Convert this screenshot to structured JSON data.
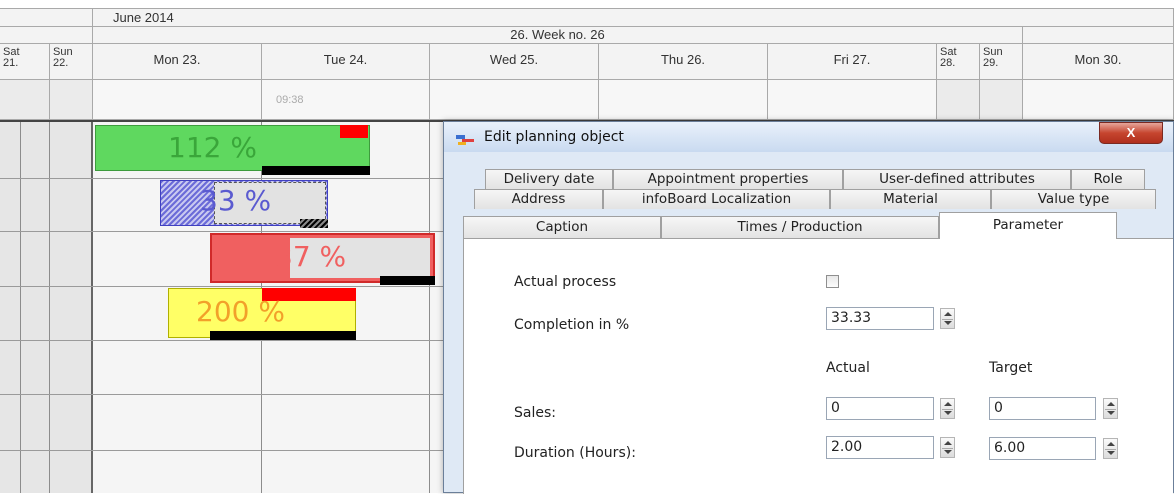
{
  "calendar": {
    "month_label": "June 2014",
    "week_label": "26. Week no. 26",
    "days": [
      {
        "label": "Sat\n21."
      },
      {
        "label": "Sun\n22."
      },
      {
        "label": "Mon 23."
      },
      {
        "label": "Tue 24."
      },
      {
        "label": "Wed 25."
      },
      {
        "label": "Thu 26."
      },
      {
        "label": "Fri 27."
      },
      {
        "label": "Sat\n28."
      },
      {
        "label": "Sun\n29."
      },
      {
        "label": "Mon 30."
      }
    ],
    "current_time": "09:38",
    "bars": [
      {
        "label": "112 %",
        "color": "#5fd85f",
        "text_color": "#3aa63a"
      },
      {
        "label": "33 %",
        "color": "#6b6bd8",
        "text_color": "#5a5ad0"
      },
      {
        "label": "37 %",
        "color": "#f06060",
        "text_color": "#f06060"
      },
      {
        "label": "200 %",
        "color": "#ffff66",
        "text_color": "#f2a02a"
      }
    ]
  },
  "dialog": {
    "title": "Edit planning object",
    "close_label": "X",
    "tabs_row1": [
      "Delivery date",
      "Appointment properties",
      "User-defined attributes",
      "Role"
    ],
    "tabs_row2": [
      "Address",
      "infoBoard Localization",
      "Material",
      "Value type"
    ],
    "tabs_row3": [
      "Caption",
      "Times / Production",
      "Parameter"
    ],
    "active_tab": "Parameter",
    "fields": {
      "actual_process_label": "Actual process",
      "completion_label": "Completion in %",
      "completion_value": "33.33",
      "actual_header": "Actual",
      "target_header": "Target",
      "sales_label": "Sales:",
      "sales_actual": "0",
      "sales_target": "0",
      "duration_label": "Duration (Hours):",
      "duration_actual": "2.00",
      "duration_target": "6.00"
    }
  }
}
